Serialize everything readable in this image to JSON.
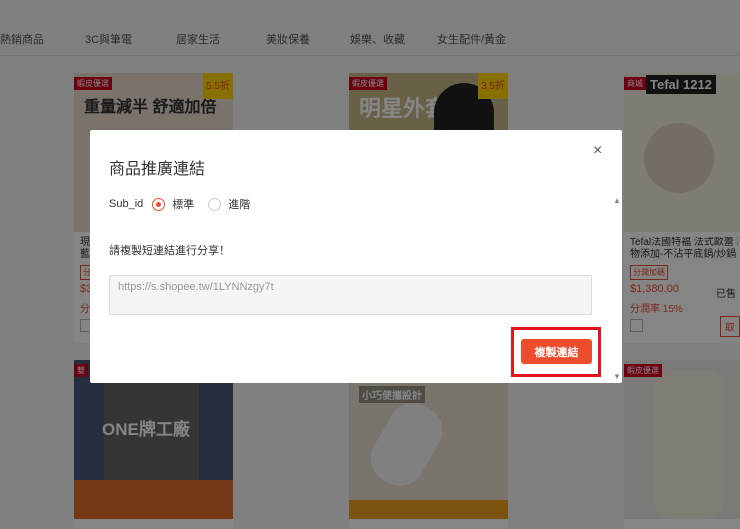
{
  "nav": {
    "items": [
      "熱銷商品",
      "3C與筆電",
      "居家生活",
      "美妝保養",
      "娛樂、收藏",
      "女生配件/黃金"
    ]
  },
  "cards": [
    {
      "badge": "蝦皮優選",
      "discount": "5.5折",
      "image_text": "重量減半 舒適加倍",
      "title": "現...",
      "title2": "藍...",
      "tag": "分潤",
      "price": "$3",
      "rate": "分"
    },
    {
      "badge": "蝦皮優選",
      "discount": "3.5折",
      "image_text": "明星外套"
    },
    {
      "badge": "商城",
      "image_text": "Tefal 1212",
      "title": "Tefal法國特福 法式歐蕾 高",
      "title2": "物添加-不沾平底鍋/炒鍋 |",
      "tag": "分潤加碼",
      "price": "$1,380.00",
      "rate": "分潤率 15%",
      "sold": "已售",
      "action": "取"
    },
    {
      "badge": "雙",
      "image_text": "ONE牌工廠"
    },
    {
      "badge": "",
      "image_text": "小巧便攜設計"
    },
    {
      "badge": "蝦皮優選",
      "image_text": ""
    }
  ],
  "modal": {
    "title": "商品推廣連結",
    "close": "×",
    "subid_label": "Sub_id",
    "options": [
      "標準",
      "進階"
    ],
    "selected": "標準",
    "hint": "請複製短連結進行分享！",
    "link": "https://s.shopee.tw/1LYNNzgy7t",
    "copy_button": "複製連結"
  },
  "colors": {
    "accent": "#ee4d2d",
    "highlight": "#e3141e"
  }
}
